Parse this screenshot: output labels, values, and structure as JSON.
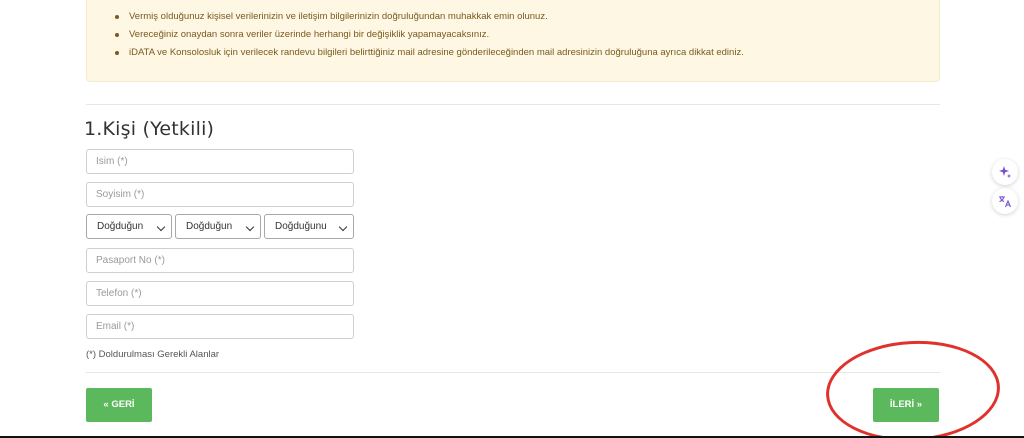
{
  "notice": {
    "items": [
      "Vermiş olduğunuz kişisel verilerinizin ve iletişim bilgilerinizin doğruluğundan muhakkak emin olunuz.",
      "Vereceğiniz onaydan sonra veriler üzerinde herhangi bir değişiklik yapamayacaksınız.",
      "iDATA ve Konsolosluk için verilecek randevu bilgileri belirttiğiniz mail adresine gönderileceğinden mail adresinizin doğruluğuna ayrıca dikkat ediniz."
    ]
  },
  "person": {
    "title": "1.Kişi (Yetkili)",
    "fields": {
      "name_placeholder": "İsim (*)",
      "surname_placeholder": "Soyisim (*)",
      "passport_placeholder": "Pasaport No (*)",
      "phone_placeholder": "Telefon (*)",
      "email_placeholder": "Email (*)"
    },
    "birth_selects": [
      "Doğduğun",
      "Doğduğun",
      "Doğduğunu"
    ],
    "required_note": "(*) Doldurulması Gerekli Alanlar"
  },
  "nav": {
    "back_label": "« GERİ",
    "next_label": "İLERİ  »"
  },
  "side_tools": {
    "ai_icon": "sparkle-icon",
    "translate_icon": "translate-icon"
  },
  "colors": {
    "button_green": "#5cb85c",
    "notice_bg": "#fdf7e3",
    "notice_text": "#7a5a1e",
    "annotation_red": "#e0322d",
    "side_icon_purple": "#7b4fd0"
  }
}
